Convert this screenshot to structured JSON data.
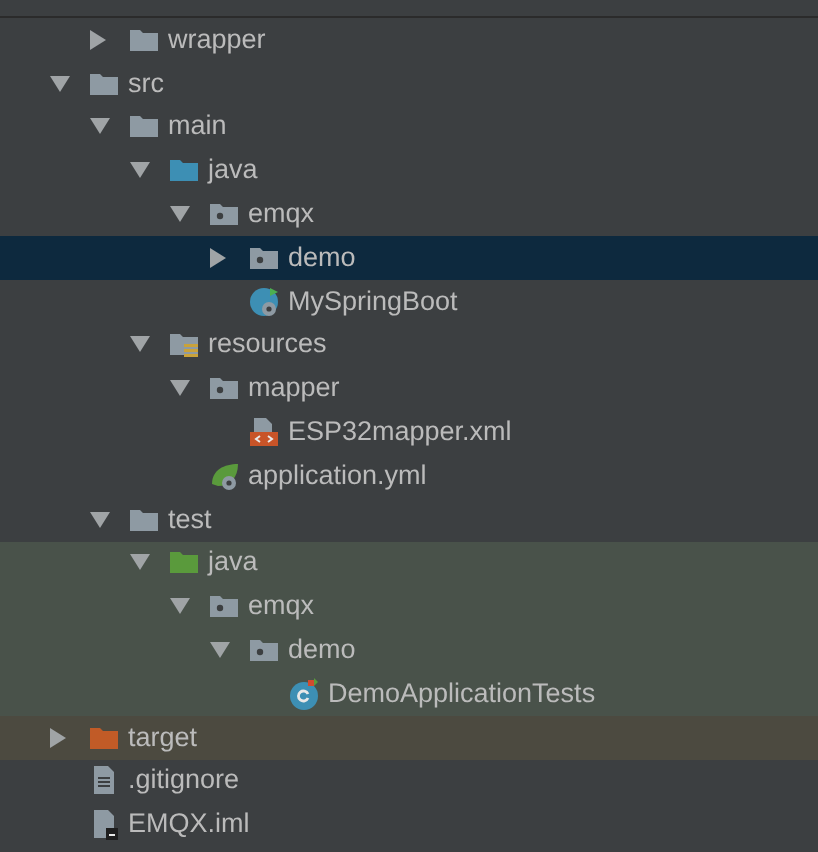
{
  "project_tree": {
    "items": [
      {
        "label": "wrapper",
        "kind": "folder",
        "expanded": false,
        "selected": false,
        "offset": true
      },
      {
        "label": "src",
        "kind": "folder",
        "expanded": true,
        "selected": false,
        "children": [
          {
            "label": "main",
            "kind": "folder",
            "expanded": true,
            "selected": false,
            "children": [
              {
                "label": "java",
                "kind": "source",
                "expanded": true,
                "selected": false,
                "children": [
                  {
                    "label": "emqx",
                    "kind": "package",
                    "expanded": true,
                    "selected": false,
                    "children": [
                      {
                        "label": "demo",
                        "kind": "package",
                        "expanded": false,
                        "selected": true
                      },
                      {
                        "label": "MySpringBoot",
                        "kind": "class",
                        "selected": false
                      }
                    ]
                  }
                ]
              },
              {
                "label": "resources",
                "kind": "resources",
                "expanded": true,
                "selected": false,
                "children": [
                  {
                    "label": "mapper",
                    "kind": "package",
                    "expanded": true,
                    "selected": false,
                    "children": [
                      {
                        "label": "ESP32mapper.xml",
                        "kind": "xml",
                        "selected": false
                      }
                    ]
                  },
                  {
                    "label": "application.yml",
                    "kind": "config",
                    "selected": false
                  }
                ]
              }
            ]
          },
          {
            "label": "test",
            "kind": "folder",
            "expanded": true,
            "selected": false,
            "children": [
              {
                "label": "java",
                "kind": "tests",
                "expanded": true,
                "selected": false,
                "color": "#49524a",
                "children": [
                  {
                    "label": "emqx",
                    "kind": "package",
                    "expanded": true,
                    "selected": false,
                    "color": "#49524a",
                    "children": [
                      {
                        "label": "demo",
                        "kind": "package",
                        "expanded": true,
                        "selected": false,
                        "color": "#49524a",
                        "children": [
                          {
                            "label": "DemoApplicationTests",
                            "kind": "test",
                            "selected": false,
                            "color": "#49524a"
                          }
                        ]
                      }
                    ]
                  }
                ]
              }
            ]
          }
        ]
      },
      {
        "label": "target",
        "kind": "excluded",
        "expanded": false,
        "selected": false,
        "color": "#4c4a40"
      },
      {
        "label": ".gitignore",
        "kind": "text",
        "selected": false
      },
      {
        "label": "EMQX.iml",
        "kind": "module",
        "selected": false
      }
    ]
  }
}
